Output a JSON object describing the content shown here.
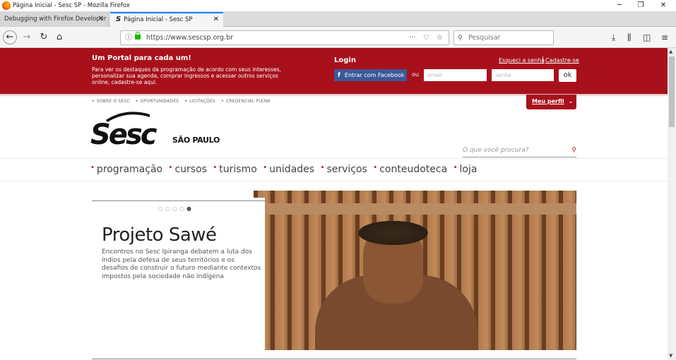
{
  "window": {
    "title": "Página Inicial - Sesc SP - Mozilla Firefox"
  },
  "tabs": [
    {
      "label": "Debugging with Firefox Developer T"
    },
    {
      "label": "Página Inicial - Sesc SP",
      "favicon": "S"
    }
  ],
  "urlbar": {
    "url": "https://www.sescsp.org.br",
    "more": "···"
  },
  "searchbar": {
    "placeholder": "Pesquisar"
  },
  "portal": {
    "title": "Um Portal para cada um!",
    "description": "Para ver os destaques da programação de acordo com seus interesses, personalizar sua agenda, comprar ingressos e acessar outros serviços online, cadastre-se aqui."
  },
  "login": {
    "title": "Login",
    "forgot": "Esqueci a senha",
    "separator": "|",
    "register": "Cadastre-se",
    "facebook_icon": "f",
    "facebook": "Entrar com Facebook",
    "or": "ou",
    "email_placeholder": "email",
    "password_placeholder": "senha",
    "ok": "ok"
  },
  "toplinks": [
    "SOBRE O SESC",
    "OPORTUNIDADES",
    "LICITAÇÕES",
    "CREDENCIAL PLENA"
  ],
  "profile": {
    "label": "Meu perfil"
  },
  "brand": {
    "logo_text": "Sesc",
    "region": "SÃO PAULO"
  },
  "site_search": {
    "placeholder": "O que você procura?"
  },
  "menu": [
    "programação",
    "cursos",
    "turismo",
    "unidades",
    "serviços",
    "conteudoteca",
    "loja"
  ],
  "hero": {
    "title": "Projeto Sawé",
    "description": "Encontros no Sesc Ipiranga debatem a luta dos índios pela defesa de seus territórios e os desafios de construir o futuro mediante contextos impostos pela sociedade não indígena",
    "slides": 5,
    "active_slide": 5
  },
  "colors": {
    "brand_red": "#a8111c",
    "facebook": "#3b5998",
    "tab_accent": "#0a84ff"
  }
}
